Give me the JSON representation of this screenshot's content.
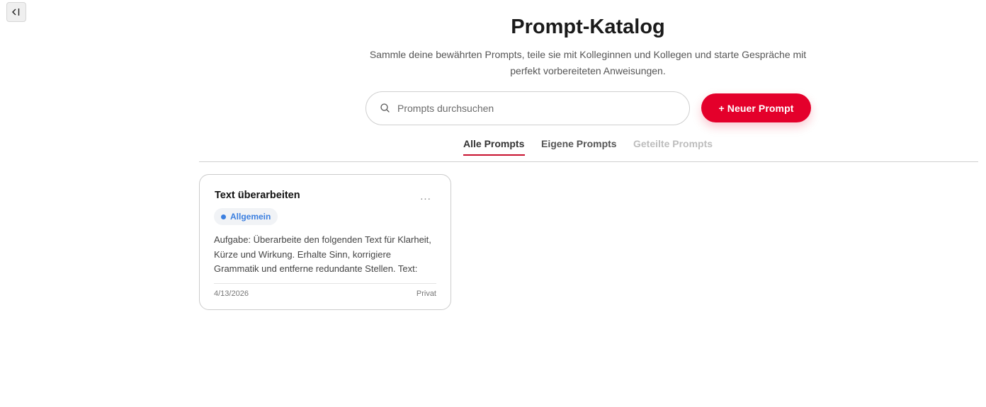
{
  "sidebar_toggle": {
    "label": "<|"
  },
  "header": {
    "title": "Prompt-Katalog",
    "subtitle_line1": "Sammle deine bewährten Prompts, teile sie mit Kolleginnen und Kollegen und starte Gespräche mit",
    "subtitle_line2": "perfekt vorbereiteten Anweisungen."
  },
  "search": {
    "placeholder": "Prompts durchsuchen",
    "value": "",
    "icon": "search-icon"
  },
  "new_button": {
    "label": "+ Neuer Prompt",
    "color": "#e4002b"
  },
  "tabs": [
    {
      "label": "Alle Prompts",
      "active": true
    },
    {
      "label": "Eigene Prompts",
      "active": false
    },
    {
      "label": "Geteilte Prompts",
      "active": false,
      "disabled": true
    }
  ],
  "prompts": [
    {
      "title": "Text überarbeiten",
      "menu": "...",
      "category": "Allgemein",
      "category_color": "#3b7fe0",
      "text_line1": "Aufgabe: Überarbeite den folgenden Text für Klarheit,",
      "text_line2": "Kürze und Wirkung. Erhalte Sinn, korrigiere",
      "text_line3": "Grammatik und entferne redundante Stellen. Text:",
      "date": "4/13/2026",
      "visibility": "Privat"
    }
  ],
  "colors": {
    "accent": "#e4002b",
    "tab_underline": "#c8102e",
    "badge_text": "#3b7fe0"
  }
}
